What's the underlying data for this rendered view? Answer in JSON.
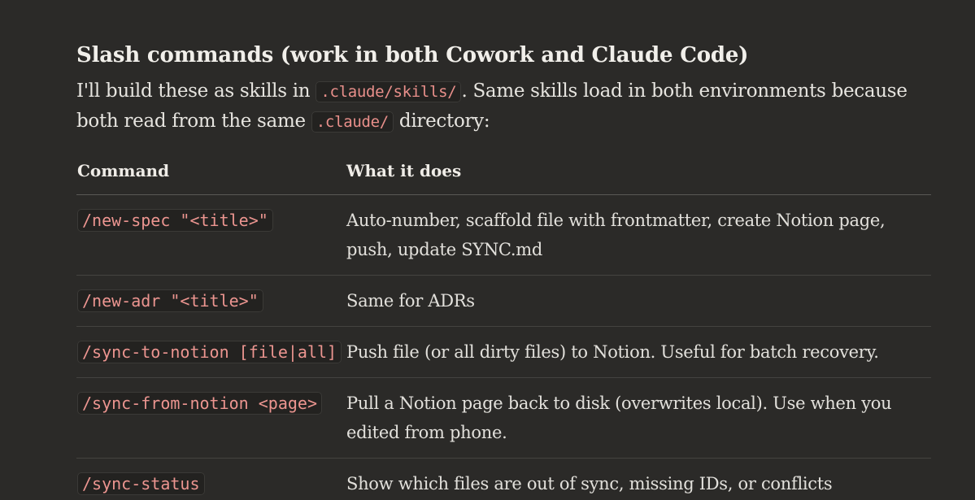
{
  "heading": "Slash commands (work in both Cowork and Claude Code)",
  "intro": {
    "part1": "I'll build these as skills in ",
    "code1": ".claude/skills/",
    "part2": ". Same skills load in both environments because both read from the same ",
    "code2": ".claude/",
    "part3": " directory:"
  },
  "table": {
    "headers": {
      "command": "Command",
      "description": "What it does"
    },
    "rows": [
      {
        "command": "/new-spec \"<title>\"",
        "description": "Auto-number, scaffold file with frontmatter, create Notion page, push, update SYNC.md"
      },
      {
        "command": "/new-adr \"<title>\"",
        "description": "Same for ADRs"
      },
      {
        "command": "/sync-to-notion [file|all]",
        "description": "Push file (or all dirty files) to Notion. Useful for batch recovery."
      },
      {
        "command": "/sync-from-notion <page>",
        "description": "Pull a Notion page back to disk (overwrites local). Use when you edited from phone."
      },
      {
        "command": "/sync-status",
        "description": "Show which files are out of sync, missing IDs, or conflicts"
      }
    ]
  }
}
